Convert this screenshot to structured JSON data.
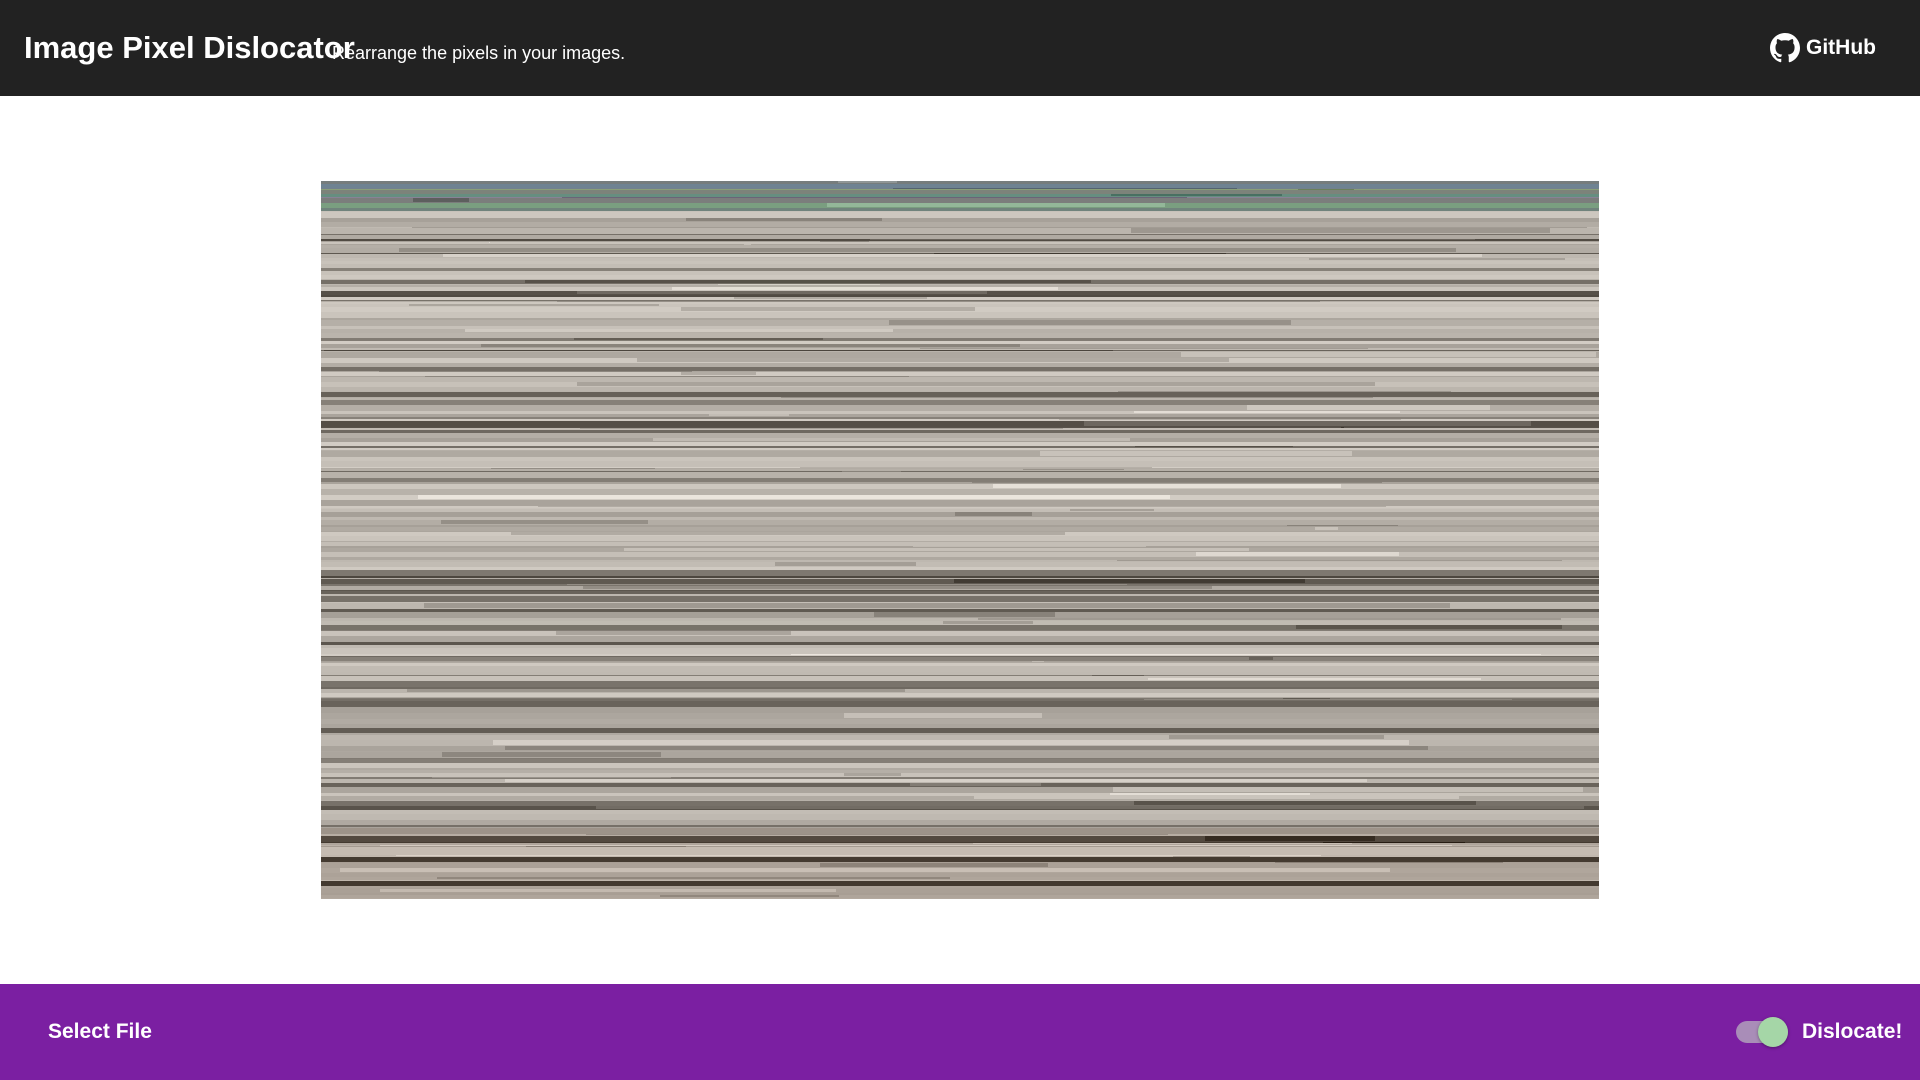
{
  "header": {
    "title": "Image Pixel Dislocator",
    "subtitle": "Rearrange the pixels in your images.",
    "github_label": "GitHub"
  },
  "canvas": {
    "icon": "dislocated-image"
  },
  "footer": {
    "select_file_label": "Select File",
    "dislocate_label": "Dislocate!",
    "dislocate_enabled": true
  },
  "colors": {
    "header_bg": "#222222",
    "footer_bg": "#7b1fa2",
    "toggle_thumb": "#a5d6a7"
  }
}
